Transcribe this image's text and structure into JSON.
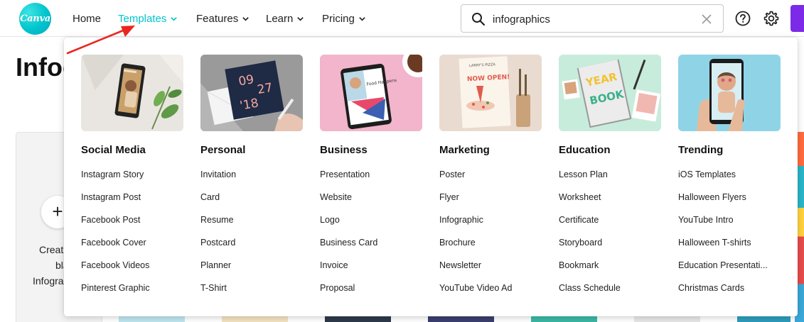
{
  "header": {
    "logo_text": "Canva",
    "nav": [
      {
        "label": "Home",
        "has_chevron": false,
        "active": false
      },
      {
        "label": "Templates",
        "has_chevron": true,
        "active": true
      },
      {
        "label": "Features",
        "has_chevron": true,
        "active": false
      },
      {
        "label": "Learn",
        "has_chevron": true,
        "active": false
      },
      {
        "label": "Pricing",
        "has_chevron": true,
        "active": false
      }
    ],
    "search": {
      "value": "infographics",
      "icon": "search-icon"
    },
    "accent_color": "#00c4cc",
    "profile_color": "#7d2ae8"
  },
  "background_page": {
    "title": "Infog",
    "create_card": {
      "line1": "Creat",
      "line2": "blan",
      "line3": "Infogra"
    }
  },
  "templates_menu": {
    "columns": [
      {
        "title": "Social Media",
        "image": "phone-on-marble-with-leaves",
        "items": [
          "Instagram Story",
          "Instagram Post",
          "Facebook Post",
          "Facebook Cover",
          "Facebook Videos",
          "Pinterest Graphic"
        ]
      },
      {
        "title": "Personal",
        "image": "card-09-27-18",
        "items": [
          "Invitation",
          "Card",
          "Resume",
          "Postcard",
          "Planner",
          "T-Shirt"
        ]
      },
      {
        "title": "Business",
        "image": "phone-on-pink-with-coffee",
        "items": [
          "Presentation",
          "Website",
          "Logo",
          "Business Card",
          "Invoice",
          "Proposal"
        ]
      },
      {
        "title": "Marketing",
        "image": "now-open-pizza-poster",
        "items": [
          "Poster",
          "Flyer",
          "Infographic",
          "Brochure",
          "Newsletter",
          "YouTube Video Ad"
        ]
      },
      {
        "title": "Education",
        "image": "yearbook-cover",
        "items": [
          "Lesson Plan",
          "Worksheet",
          "Certificate",
          "Storyboard",
          "Bookmark",
          "Class Schedule"
        ]
      },
      {
        "title": "Trending",
        "image": "hand-holding-phone",
        "items": [
          "iOS Templates",
          "Halloween Flyers",
          "YouTube Intro",
          "Halloween T-shirts",
          "Education Presentati...",
          "Christmas Cards"
        ]
      }
    ],
    "thumb_texts": {
      "personal_date_line1": "09",
      "personal_date_line2": "27",
      "personal_date_line3": "'18",
      "business_phone_text": "Food Happens",
      "marketing_header": "LARRY'S PIZZA",
      "marketing_headline": "NOW OPEN!",
      "education_word1": "YEAR",
      "education_word2": "BOOK"
    }
  },
  "annotation": {
    "type": "red-arrow",
    "color": "#e8271f"
  }
}
